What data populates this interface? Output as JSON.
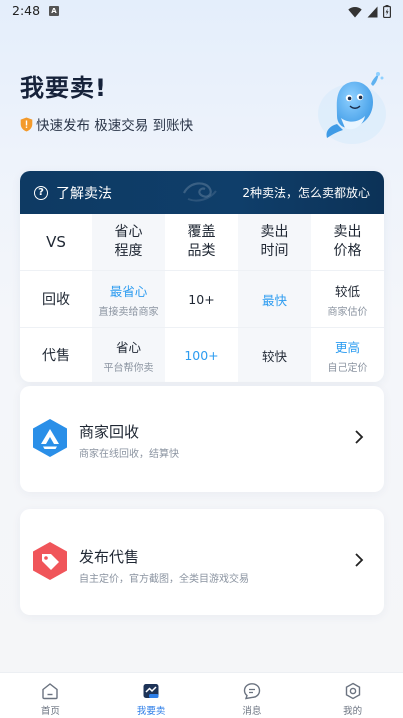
{
  "status_bar": {
    "time": "2:48",
    "notif_badge": "A"
  },
  "hero": {
    "title": "我要卖!",
    "subtitle": "快速发布 极速交易 到账快"
  },
  "compare": {
    "title": "了解卖法",
    "right_text": "2种卖法，怎么卖都放心",
    "corner": "VS",
    "headers": [
      [
        "省心",
        "程度"
      ],
      [
        "覆盖",
        "品类"
      ],
      [
        "卖出",
        "时间"
      ],
      [
        "卖出",
        "价格"
      ]
    ],
    "rows": [
      {
        "label": "回收",
        "cells": [
          {
            "main": "最省心",
            "sub": "直接卖给商家",
            "blue": true
          },
          {
            "main": "10+",
            "sub": "",
            "blue": false
          },
          {
            "main": "最快",
            "sub": "",
            "blue": true
          },
          {
            "main": "较低",
            "sub": "商家估价",
            "blue": false
          }
        ]
      },
      {
        "label": "代售",
        "cells": [
          {
            "main": "省心",
            "sub": "平台帮你卖",
            "blue": false
          },
          {
            "main": "100+",
            "sub": "",
            "blue": true
          },
          {
            "main": "较快",
            "sub": "",
            "blue": false
          },
          {
            "main": "更高",
            "sub": "自己定价",
            "blue": true
          }
        ]
      }
    ]
  },
  "options": [
    {
      "title": "商家回收",
      "desc": "商家在线回收，结算快"
    },
    {
      "title": "发布代售",
      "desc": "自主定价，官方截图，全类目游戏交易"
    }
  ],
  "tabs": [
    {
      "label": "首页",
      "icon": "home-icon"
    },
    {
      "label": "我要卖",
      "icon": "sell-icon"
    },
    {
      "label": "消息",
      "icon": "message-icon"
    },
    {
      "label": "我的",
      "icon": "profile-icon"
    }
  ],
  "colors": {
    "accent": "#2d9cf0",
    "header_bg": "#0f3e6a",
    "tab_active": "#2d7ee8",
    "recycle_icon": "#2a8fe8",
    "consign_icon": "#f0555a"
  }
}
